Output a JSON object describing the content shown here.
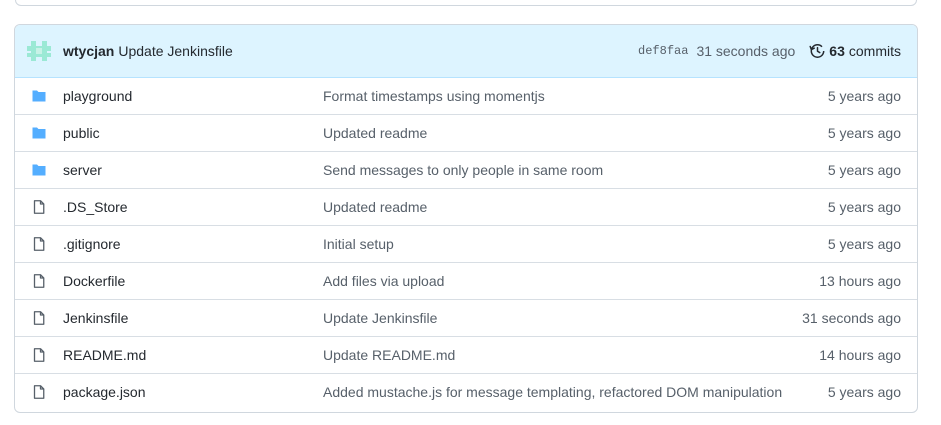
{
  "latest_commit": {
    "author": "wtycjan",
    "message": "Update Jenkinsfile",
    "sha": "def8faa",
    "time": "31 seconds ago",
    "commit_count": "63",
    "commits_label": "commits"
  },
  "files": [
    {
      "type": "directory",
      "name": "playground",
      "message": "Format timestamps using momentjs",
      "age": "5 years ago"
    },
    {
      "type": "directory",
      "name": "public",
      "message": "Updated readme",
      "age": "5 years ago"
    },
    {
      "type": "directory",
      "name": "server",
      "message": "Send messages to only people in same room",
      "age": "5 years ago"
    },
    {
      "type": "file",
      "name": ".DS_Store",
      "message": "Updated readme",
      "age": "5 years ago"
    },
    {
      "type": "file",
      "name": ".gitignore",
      "message": "Initial setup",
      "age": "5 years ago"
    },
    {
      "type": "file",
      "name": "Dockerfile",
      "message": "Add files via upload",
      "age": "13 hours ago"
    },
    {
      "type": "file",
      "name": "Jenkinsfile",
      "message": "Update Jenkinsfile",
      "age": "31 seconds ago"
    },
    {
      "type": "file",
      "name": "README.md",
      "message": "Update README.md",
      "age": "14 hours ago"
    },
    {
      "type": "file",
      "name": "package.json",
      "message": "Added mustache.js for message templating, refactored DOM manipulation",
      "age": "5 years ago"
    }
  ],
  "colors": {
    "header_bg": "#ddf4ff",
    "folder_icon": "#54aeff",
    "file_icon": "#57606a",
    "avatar": "#9be9d5"
  }
}
